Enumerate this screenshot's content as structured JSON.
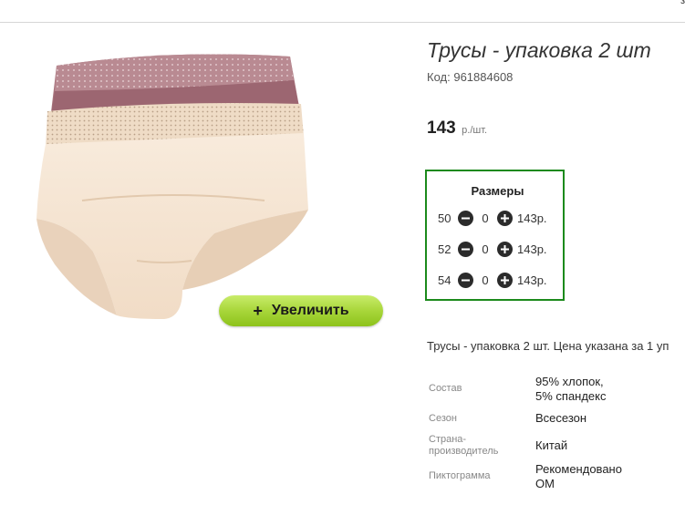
{
  "header": {
    "corner_text": "з"
  },
  "product": {
    "title": "Трусы - упаковка 2 шт",
    "code_label": "Код:",
    "code_value": "961884608",
    "price": "143",
    "price_unit": "р./шт.",
    "zoom_button_label": "Увеличить",
    "zoom_button_icon": "plus-icon",
    "description": "Трусы - упаковка 2 шт. Цена указана за 1 уп"
  },
  "sizes": {
    "title": "Размеры",
    "rows": [
      {
        "size": "50",
        "qty": "0",
        "price": "143р."
      },
      {
        "size": "52",
        "qty": "0",
        "price": "143р."
      },
      {
        "size": "54",
        "qty": "0",
        "price": "143р."
      }
    ]
  },
  "properties": [
    {
      "label": "Состав",
      "value_lines": [
        "95% хлопок,",
        "5% спандекс"
      ]
    },
    {
      "label": "Сезон",
      "value_lines": [
        "Всесезон"
      ]
    },
    {
      "label_lines": [
        "Страна-",
        "производитель"
      ],
      "value_lines": [
        "Китай"
      ]
    },
    {
      "label": "Пиктограмма",
      "value_lines": [
        "Рекомендовано",
        "ОМ"
      ]
    }
  ],
  "colors": {
    "accent_green_border": "#1c8a1c",
    "zoom_button": "#a8d63a",
    "briefs_pink": "#b27f88",
    "briefs_cream": "#f6e6d4"
  }
}
